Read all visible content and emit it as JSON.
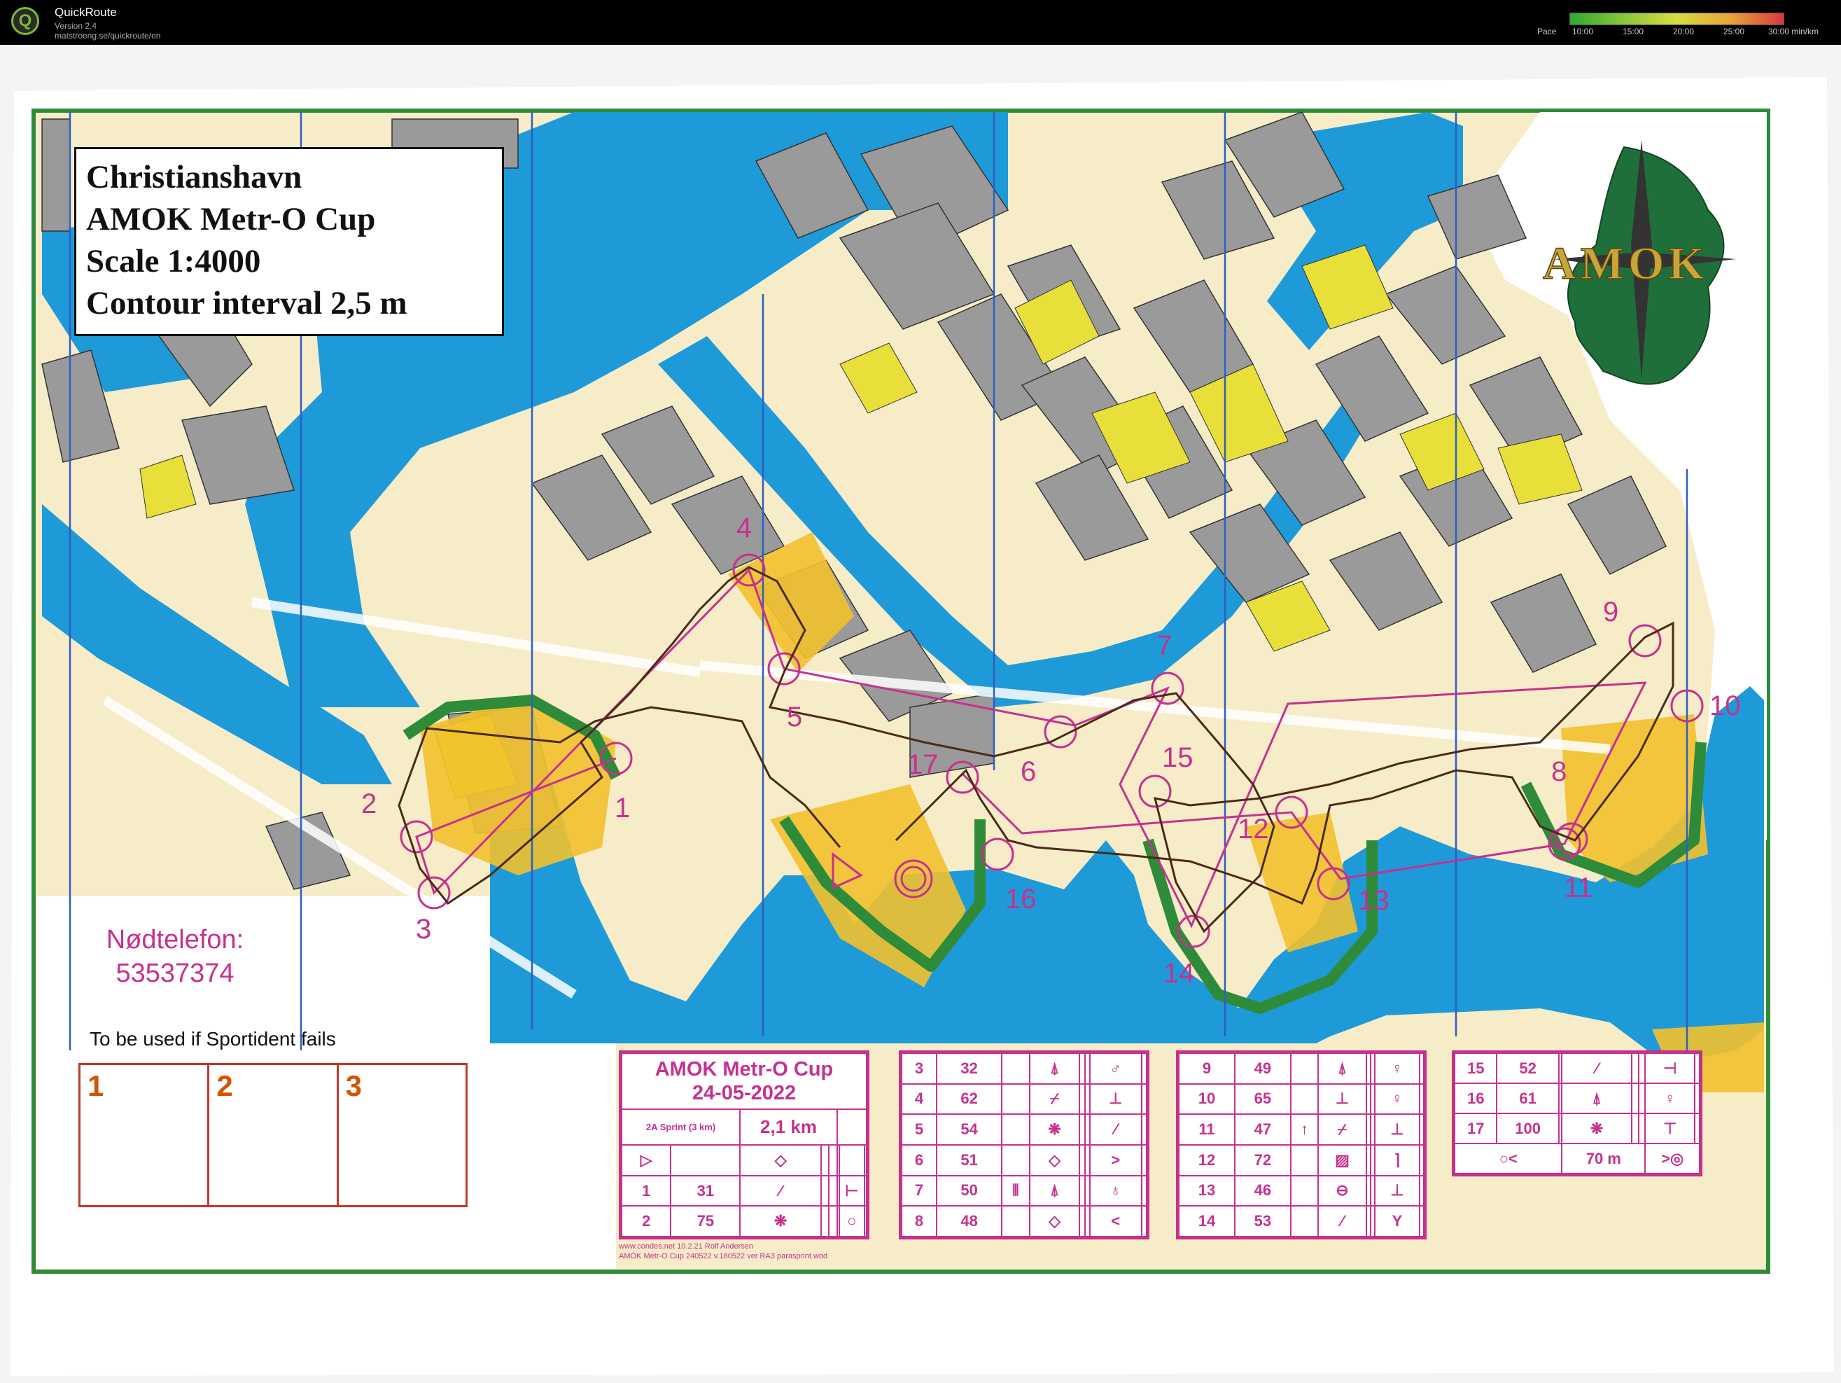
{
  "app": {
    "name": "QuickRoute",
    "version": "Version 2.4",
    "url": "matstroeng.se/quickroute/en",
    "legend_label": "Pace",
    "legend_ticks": [
      "10:00",
      "15:00",
      "20:00",
      "25:00",
      "30:00 min/km"
    ]
  },
  "map": {
    "title_lines": [
      "Christianshavn",
      "AMOK Metr-O Cup",
      "Scale 1:4000",
      "Contour interval 2,5 m"
    ],
    "logo_text": "AMOK",
    "emergency_label": "Nødtelefon:",
    "emergency_number": "53537374",
    "sportident_note": "To be used if Sportident fails",
    "backup_boxes": [
      "1",
      "2",
      "3"
    ],
    "controls": [
      "1",
      "2",
      "3",
      "4",
      "5",
      "6",
      "7",
      "8",
      "9",
      "10",
      "11",
      "12",
      "13",
      "14",
      "15",
      "16",
      "17"
    ]
  },
  "descriptions": {
    "event": "AMOK Metr-O Cup",
    "date": "24-05-2022",
    "course": "2A Sprint (3 km)",
    "length": "2,1 km",
    "first_block": [
      {
        "n": "1",
        "code": "31",
        "sym": "⁄",
        "extra": "⊢"
      },
      {
        "n": "2",
        "code": "75",
        "sym": "❋",
        "extra": "○"
      }
    ],
    "blocks": [
      [
        {
          "n": "3",
          "code": "32",
          "sym": "⍋",
          "extra": "♂"
        },
        {
          "n": "4",
          "code": "62",
          "sym": "⌿",
          "extra": "⊥"
        },
        {
          "n": "5",
          "code": "54",
          "sym": "❋",
          "extra": "⁄"
        },
        {
          "n": "6",
          "code": "51",
          "sym": "◇",
          "extra": ">"
        },
        {
          "n": "7",
          "code": "50",
          "sym": "⍋",
          "extra": "♁"
        },
        {
          "n": "8",
          "code": "48",
          "sym": "◇",
          "extra": "<"
        }
      ],
      [
        {
          "n": "9",
          "code": "49",
          "sym": "⍋",
          "extra": "♀"
        },
        {
          "n": "10",
          "code": "65",
          "sym": "⊥",
          "extra": "♀"
        },
        {
          "n": "11",
          "code": "47",
          "sym": "⌿",
          "extra": "⊥"
        },
        {
          "n": "12",
          "code": "72",
          "sym": "▨",
          "extra": "⌉"
        },
        {
          "n": "13",
          "code": "46",
          "sym": "⊖",
          "extra": "⊥"
        },
        {
          "n": "14",
          "code": "53",
          "sym": "⁄",
          "extra": "Y"
        }
      ],
      [
        {
          "n": "15",
          "code": "52",
          "sym": "⁄",
          "extra": "⊣"
        },
        {
          "n": "16",
          "code": "61",
          "sym": "⍋",
          "extra": "♀"
        },
        {
          "n": "17",
          "code": "100",
          "sym": "❋",
          "extra": "⊤"
        }
      ]
    ],
    "finish_text": "70 m",
    "footer_line1": "www.condes.net 10.2.21 Rolf Andersen",
    "footer_line2": "AMOK Metr-O Cup 240522 v.180522 ver RA3 parasprint.wod"
  },
  "colors": {
    "water": "#1e9ad8",
    "land": "#f6ecc8",
    "building": "#9a9a9a",
    "open": "#f2c12e",
    "green": "#2e8b3a",
    "overprint": "#c6318f",
    "route": "#4a2b1a"
  }
}
